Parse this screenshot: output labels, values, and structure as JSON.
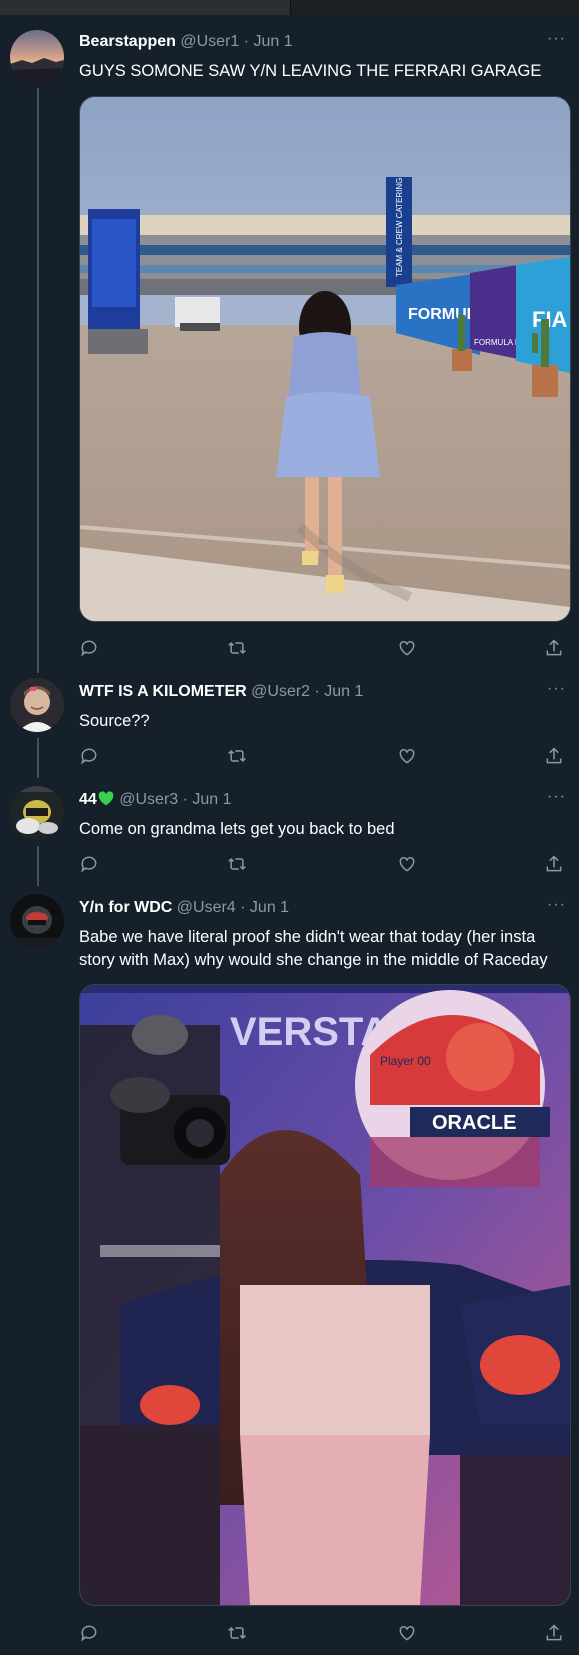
{
  "tweets": [
    {
      "name": "Bearstappen",
      "handle": "@User1",
      "date": "Jun 1",
      "text": "GUYS SOMONE SAW Y/N LEAVING THE FERRARI GARAGE",
      "media_description": "photo",
      "more": "···"
    },
    {
      "name": "WTF IS A KILOMETER",
      "handle": "@User2",
      "date": "Jun 1",
      "text": "Source??",
      "more": "···"
    },
    {
      "name": "44",
      "handle": "@User3",
      "date": "Jun 1",
      "text": "Come on grandma lets get you back to bed",
      "more": "···"
    },
    {
      "name": "Y/n for WDC",
      "handle": "@User4",
      "date": "Jun 1",
      "text": "Babe we have literal proof she didn't wear that today (her insta story with Max) why would she change in the middle of Raceday",
      "more": "···"
    }
  ],
  "separator": " · ",
  "photo1_signs": {
    "tower": "TEAM & CREW CATERING",
    "banner1": "FORMULA E",
    "banner2": "FIA",
    "banner3": "FORMULA E"
  },
  "photo2_signs": {
    "backdrop": "VERSTA",
    "helmet_brand": "ORACLE",
    "helmet_text": "Player 00"
  },
  "colors": {
    "background": "#15202b",
    "secondary_text": "#8b98a5",
    "thread_line": "#3d5466",
    "heart_emoji": "#3ad24a"
  },
  "icons": [
    "reply-icon",
    "retweet-icon",
    "like-icon",
    "share-icon",
    "more-icon",
    "green-heart-emoji"
  ]
}
